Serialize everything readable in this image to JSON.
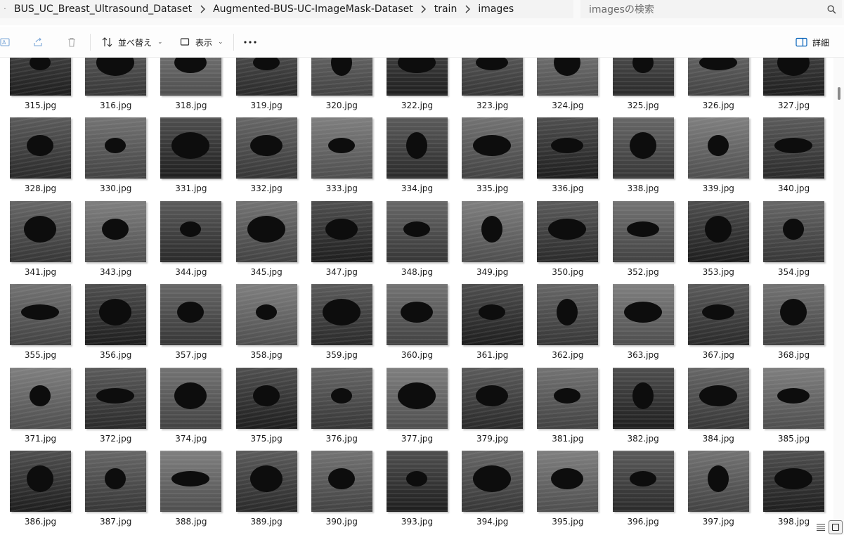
{
  "breadcrumb": {
    "items": [
      "BUS_UC_Breast_Ultrasound_Dataset",
      "Augmented-BUS-UC-ImageMask-Dataset",
      "train",
      "images"
    ]
  },
  "search": {
    "placeholder": "imagesの検索"
  },
  "toolbar": {
    "sort_label": "並べ替え",
    "view_label": "表示",
    "details_label": "詳細"
  },
  "files": {
    "rows": [
      [
        "315.jpg",
        "316.jpg",
        "318.jpg",
        "319.jpg",
        "320.jpg",
        "322.jpg",
        "323.jpg",
        "324.jpg",
        "325.jpg",
        "326.jpg",
        "327.jpg"
      ],
      [
        "328.jpg",
        "330.jpg",
        "331.jpg",
        "332.jpg",
        "333.jpg",
        "334.jpg",
        "335.jpg",
        "336.jpg",
        "338.jpg",
        "339.jpg",
        "340.jpg"
      ],
      [
        "341.jpg",
        "343.jpg",
        "344.jpg",
        "345.jpg",
        "347.jpg",
        "348.jpg",
        "349.jpg",
        "350.jpg",
        "352.jpg",
        "353.jpg",
        "354.jpg"
      ],
      [
        "355.jpg",
        "356.jpg",
        "357.jpg",
        "358.jpg",
        "359.jpg",
        "360.jpg",
        "361.jpg",
        "362.jpg",
        "363.jpg",
        "367.jpg",
        "368.jpg"
      ],
      [
        "371.jpg",
        "372.jpg",
        "374.jpg",
        "375.jpg",
        "376.jpg",
        "377.jpg",
        "379.jpg",
        "381.jpg",
        "382.jpg",
        "384.jpg",
        "385.jpg"
      ],
      [
        "386.jpg",
        "387.jpg",
        "388.jpg",
        "389.jpg",
        "390.jpg",
        "393.jpg",
        "394.jpg",
        "395.jpg",
        "396.jpg",
        "397.jpg",
        "398.jpg"
      ]
    ]
  },
  "icons": {
    "search": "search-icon",
    "sort": "sort-icon",
    "view": "view-icon",
    "more": "more-icon",
    "details": "details-pane-icon",
    "list_view": "list-view-icon",
    "tiles_view": "tiles-view-icon"
  },
  "colors": {
    "accent": "#005fb8",
    "thumb_bg": "#2b2b2b",
    "toolbar_bg": "#fdfdfd"
  }
}
